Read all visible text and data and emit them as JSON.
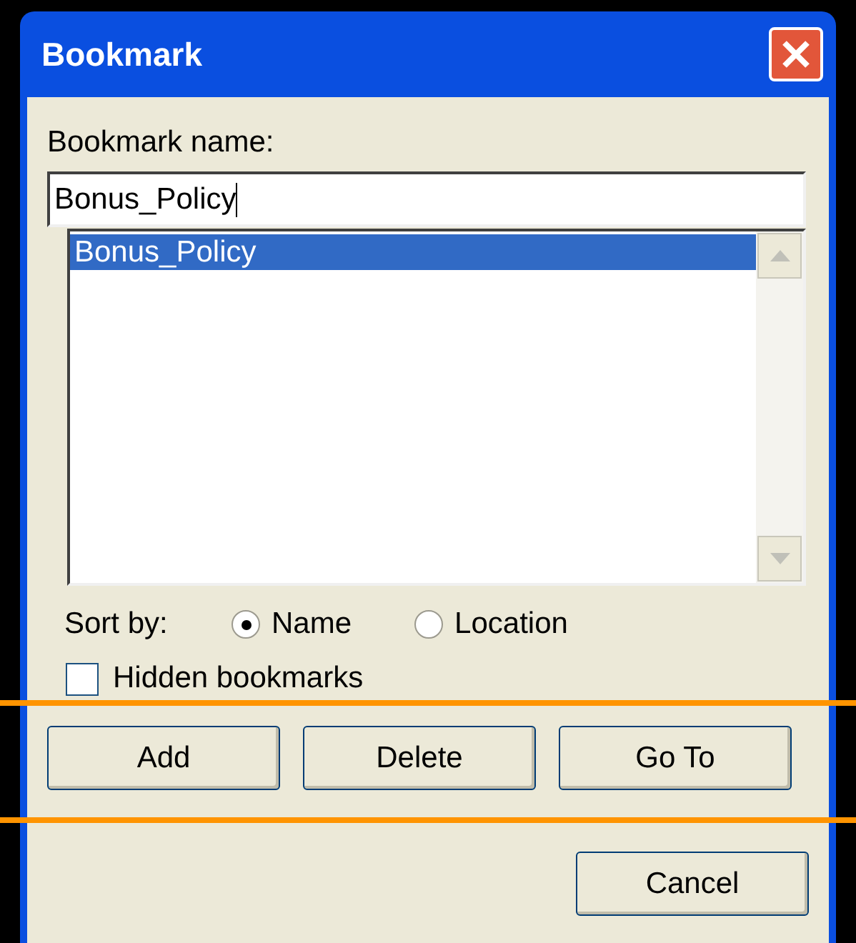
{
  "window": {
    "title": "Bookmark"
  },
  "name_field": {
    "label": "Bookmark name:",
    "value": "Bonus_Policy"
  },
  "bookmarks": [
    {
      "label": "Bonus_Policy",
      "selected": true
    }
  ],
  "sort_by": {
    "label": "Sort by:",
    "options": [
      {
        "label": "Name",
        "selected": true
      },
      {
        "label": "Location",
        "selected": false
      }
    ]
  },
  "hidden_bookmarks": {
    "label": "Hidden bookmarks",
    "checked": false
  },
  "buttons": [
    {
      "label": "Add"
    },
    {
      "label": "Delete"
    },
    {
      "label": "Go To"
    }
  ],
  "cancel": {
    "label": "Cancel"
  }
}
